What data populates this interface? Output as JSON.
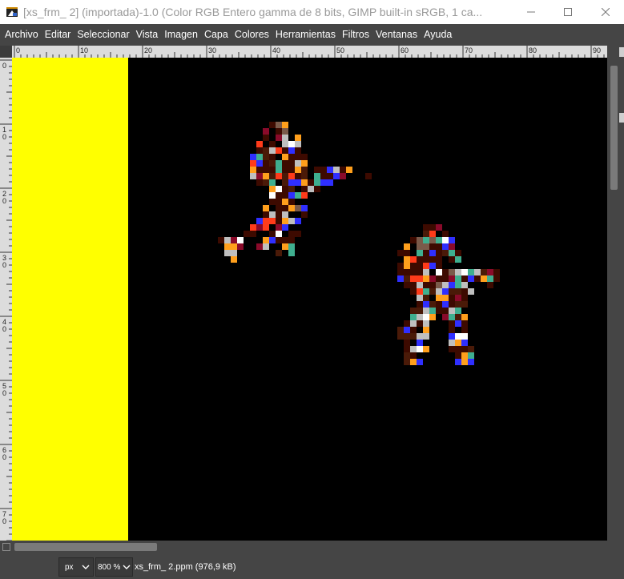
{
  "window": {
    "title": "[xs_frm_    2] (importada)-1.0 (Color RGB Entero gamma de 8 bits, GIMP built-in sRGB, 1 ca..."
  },
  "menu": [
    "Archivo",
    "Editar",
    "Seleccionar",
    "Vista",
    "Imagen",
    "Capa",
    "Colores",
    "Herramientas",
    "Filtros",
    "Ventanas",
    "Ayuda"
  ],
  "ruler": {
    "h_labels": [
      "0",
      "10",
      "20",
      "30",
      "40",
      "50",
      "60",
      "70",
      "80",
      "90"
    ],
    "v_labels": [
      "0",
      "10",
      "20",
      "30",
      "40",
      "50",
      "60",
      "70"
    ]
  },
  "status": {
    "unit": "px",
    "zoom": "800 %",
    "file_info": "xs_frm_    2.ppm (976,9 kB)"
  },
  "icons": {
    "app": "gimp-icon",
    "minimize": "minimize-icon",
    "maximize": "maximize-icon",
    "close": "close-icon",
    "unit_chevron": "chevron-down-icon",
    "zoom_chevron": "chevron-down-icon",
    "navigate": "navigate-icon"
  },
  "colors": {
    "canvas_bg": "#000000",
    "yellow_strip": "#ffff00",
    "sprite_palette": [
      "#3d0a00",
      "#4a1a08",
      "#ff9f1c",
      "#2f2fff",
      "#3faf8f",
      "#bfbfbf",
      "#ffffff",
      "#ff3b1a",
      "#8a0a2a",
      "#7a5a4a",
      "#1a1aff"
    ]
  }
}
